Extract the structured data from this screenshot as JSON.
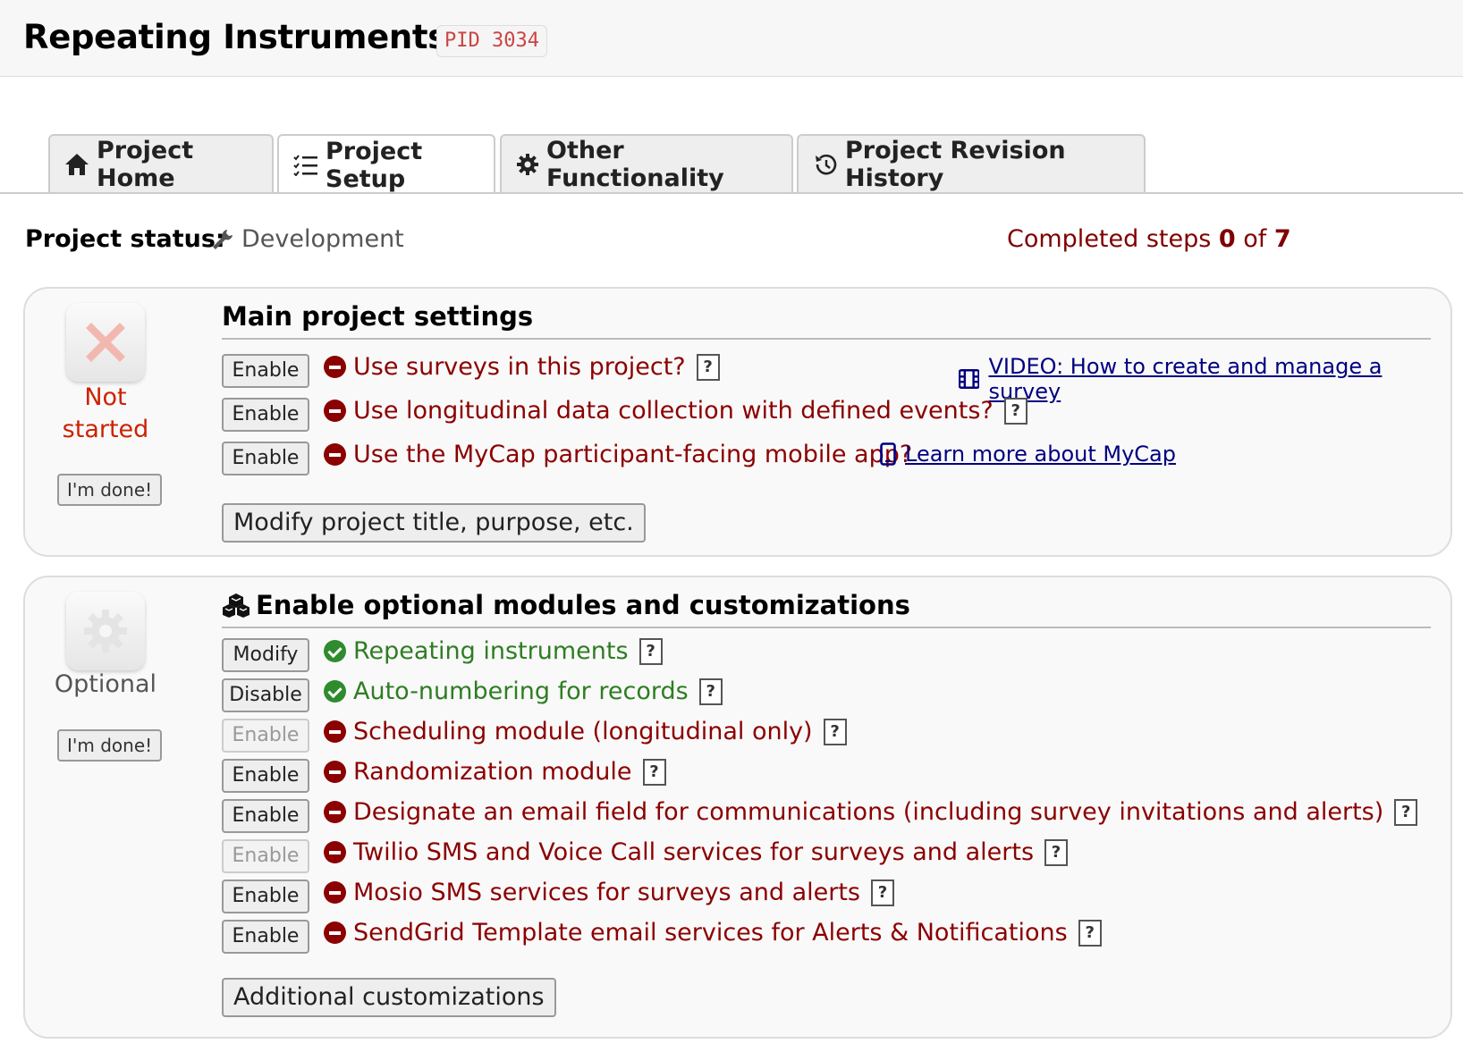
{
  "header": {
    "title": "Repeating Instruments",
    "pid": "PID 3034"
  },
  "tabs": [
    {
      "label": "Project Home",
      "icon": "home-icon",
      "active": false
    },
    {
      "label": "Project Setup",
      "icon": "list-check-icon",
      "active": true
    },
    {
      "label": "Other Functionality",
      "icon": "gear-icon",
      "active": false
    },
    {
      "label": "Project Revision History",
      "icon": "history-icon",
      "active": false
    }
  ],
  "status": {
    "label": "Project status:",
    "value": "Development",
    "icon": "wrench-icon",
    "completed_prefix": "Completed steps ",
    "completed_count": "0",
    "completed_of": " of ",
    "completed_total": "7"
  },
  "main_settings": {
    "title": "Main project settings",
    "step_status_line1": "Not",
    "step_status_line2": "started",
    "done_label": "I'm done!",
    "items": [
      {
        "button": "Enable",
        "label": "Use surveys in this project?",
        "state": "off"
      },
      {
        "button": "Enable",
        "label": "Use longitudinal data collection with defined events?",
        "state": "off"
      },
      {
        "button": "Enable",
        "label": "Use the MyCap participant-facing mobile app?",
        "state": "off"
      }
    ],
    "video_link": "VIDEO: How to create and manage a survey",
    "mycap_link": "Learn more about MyCap",
    "modify_button": "Modify project title, purpose, etc.",
    "help_glyph": "?"
  },
  "optional_modules": {
    "title": "Enable optional modules and customizations",
    "step_status": "Optional",
    "done_label": "I'm done!",
    "items": [
      {
        "button": "Modify",
        "label": "Repeating instruments",
        "state": "on",
        "button_disabled": false
      },
      {
        "button": "Disable",
        "label": "Auto-numbering for records",
        "state": "on",
        "button_disabled": false
      },
      {
        "button": "Enable",
        "label": "Scheduling module (longitudinal only)",
        "state": "off",
        "button_disabled": true
      },
      {
        "button": "Enable",
        "label": "Randomization module",
        "state": "off",
        "button_disabled": false
      },
      {
        "button": "Enable",
        "label": "Designate an email field for communications (including survey invitations and alerts)",
        "state": "off",
        "button_disabled": false
      },
      {
        "button": "Enable",
        "label": "Twilio SMS and Voice Call services for surveys and alerts",
        "state": "off",
        "button_disabled": true
      },
      {
        "button": "Enable",
        "label": "Mosio SMS services for surveys and alerts",
        "state": "off",
        "button_disabled": false
      },
      {
        "button": "Enable",
        "label": "SendGrid Template email services for Alerts & Notifications",
        "state": "off",
        "button_disabled": false
      }
    ],
    "additional_button": "Additional customizations"
  },
  "colors": {
    "error_red": "#8b0000",
    "success_green": "#2e7d22",
    "link_navy": "#000080",
    "pid_red": "#cc4444"
  }
}
